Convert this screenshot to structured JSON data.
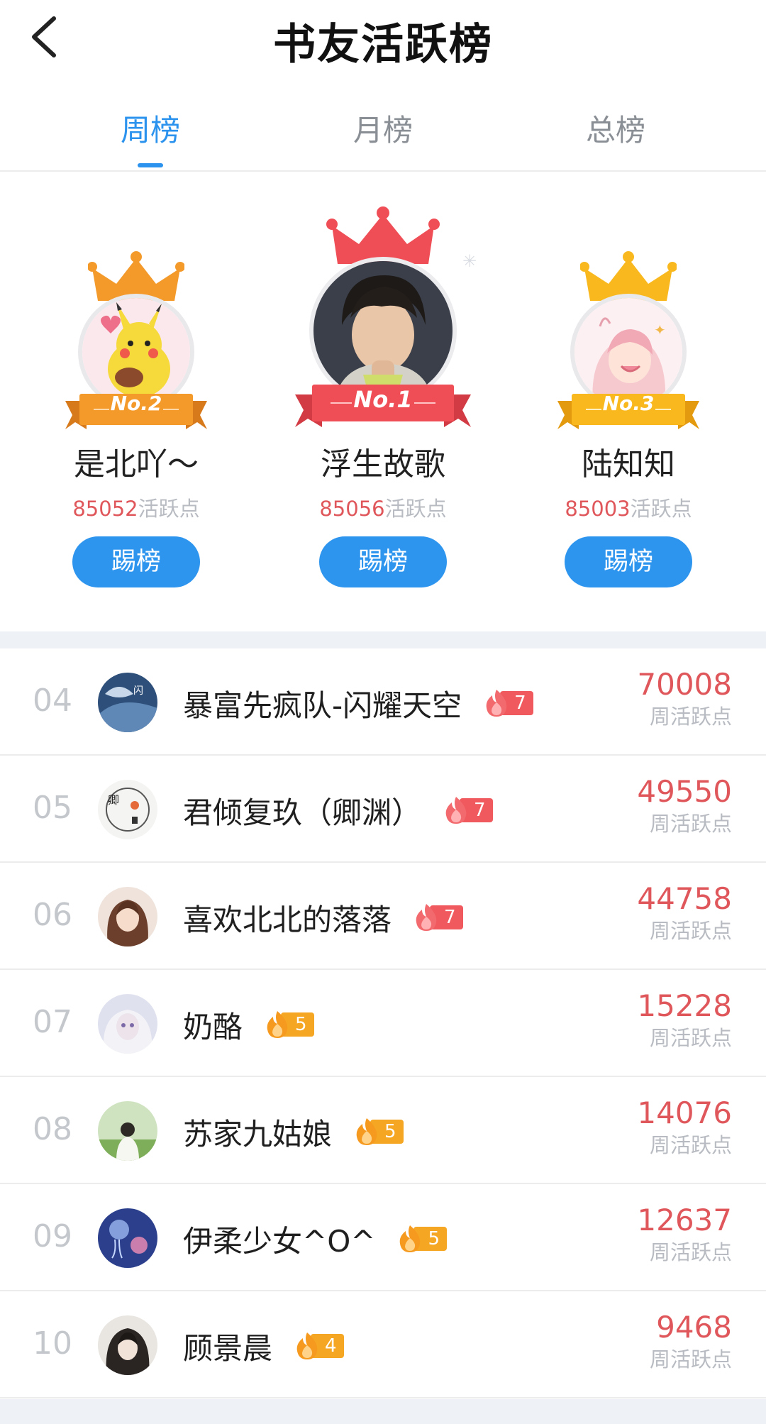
{
  "header": {
    "title": "书友活跃榜",
    "back_icon": "chevron-left-icon"
  },
  "tabs": [
    {
      "label": "周榜",
      "active": true
    },
    {
      "label": "月榜",
      "active": false
    },
    {
      "label": "总榜",
      "active": false
    }
  ],
  "podium": {
    "points_unit": "活跃点",
    "kick_label": "踢榜",
    "entries": [
      {
        "rank_label": "No.2",
        "name": "是北吖～",
        "points": "85052",
        "theme": "#f39a2b"
      },
      {
        "rank_label": "No.1",
        "name": "浮生故歌",
        "points": "85056",
        "theme": "#f04e56"
      },
      {
        "rank_label": "No.3",
        "name": "陆知知",
        "points": "85003",
        "theme": "#f8b81e"
      }
    ]
  },
  "list": {
    "unit": "周活跃点",
    "rows": [
      {
        "rank": "04",
        "name": "暴富先疯队-闪耀天空",
        "level": "7",
        "level_color": "red",
        "points": "70008"
      },
      {
        "rank": "05",
        "name": "君倾复玖（卿渊）",
        "level": "7",
        "level_color": "red",
        "points": "49550"
      },
      {
        "rank": "06",
        "name": "喜欢北北的落落",
        "level": "7",
        "level_color": "red",
        "points": "44758"
      },
      {
        "rank": "07",
        "name": "奶酪",
        "level": "5",
        "level_color": "orange",
        "points": "15228"
      },
      {
        "rank": "08",
        "name": "苏家九姑娘",
        "level": "5",
        "level_color": "orange",
        "points": "14076"
      },
      {
        "rank": "09",
        "name": "伊柔少女^O^",
        "level": "5",
        "level_color": "orange",
        "points": "12637"
      },
      {
        "rank": "10",
        "name": "顾景晨",
        "level": "4",
        "level_color": "orange",
        "points": "9468"
      }
    ]
  }
}
